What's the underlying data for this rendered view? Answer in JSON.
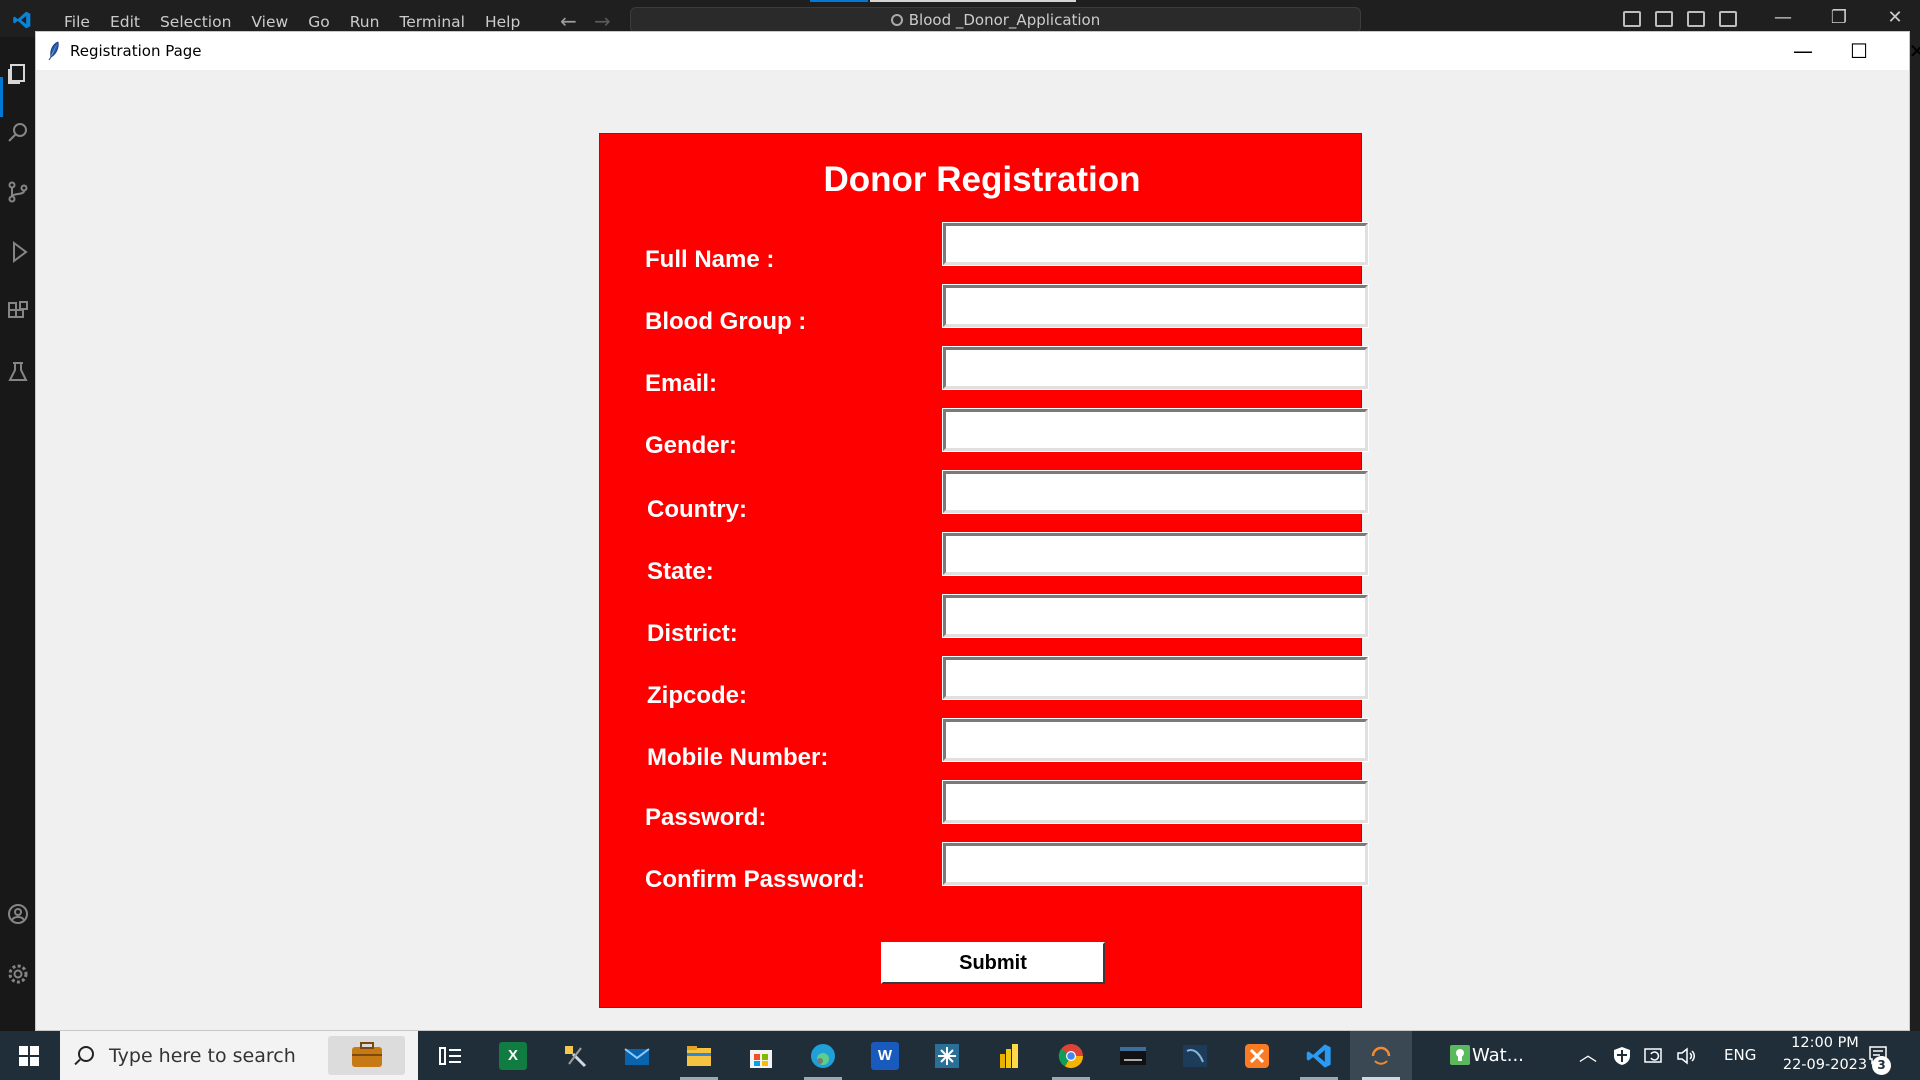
{
  "vscode": {
    "menu": [
      "File",
      "Edit",
      "Selection",
      "View",
      "Go",
      "Run",
      "Terminal",
      "Help"
    ],
    "search_label": "Blood _Donor_Application"
  },
  "window": {
    "title": "Registration Page",
    "minimize": "—",
    "maximize": "☐",
    "close": "✕"
  },
  "form": {
    "title": "Donor Registration",
    "fields": [
      {
        "label": "Full Name :",
        "value": ""
      },
      {
        "label": "Blood Group :",
        "value": ""
      },
      {
        "label": "Email:",
        "value": ""
      },
      {
        "label": "Gender:",
        "value": ""
      },
      {
        "label": "Country:",
        "value": ""
      },
      {
        "label": "State:",
        "value": ""
      },
      {
        "label": "District:",
        "value": ""
      },
      {
        "label": "Zipcode:",
        "value": ""
      },
      {
        "label": "Mobile Number:",
        "value": ""
      },
      {
        "label": "Password:",
        "value": ""
      },
      {
        "label": "Confirm Password:",
        "value": ""
      }
    ],
    "submit_label": "Submit"
  },
  "taskbar": {
    "search_placeholder": "Type here to search",
    "pinned_apps": [
      {
        "name": "task-view-icon"
      },
      {
        "name": "excel-icon",
        "color": "#107c41"
      },
      {
        "name": "tools-icon"
      },
      {
        "name": "mail-icon",
        "color": "#0a64ad"
      },
      {
        "name": "file-explorer-icon",
        "color": "#f5c242"
      },
      {
        "name": "microsoft-store-icon"
      },
      {
        "name": "edge-icon",
        "color": "#1fa0d8"
      },
      {
        "name": "word-icon",
        "color": "#185abd"
      },
      {
        "name": "snowflake-app-icon"
      },
      {
        "name": "power-bi-icon",
        "color": "#f2c811"
      },
      {
        "name": "chrome-icon"
      },
      {
        "name": "mysql-icon"
      },
      {
        "name": "mysql-workbench-icon"
      },
      {
        "name": "xampp-icon",
        "color": "#fb7a24"
      },
      {
        "name": "vscode-icon",
        "color": "#0078d4"
      },
      {
        "name": "python-tk-icon"
      }
    ],
    "watch_label": "Wat...",
    "language": "ENG",
    "time": "12:00 PM",
    "date": "22-09-2023",
    "notification_count": "3"
  },
  "colors": {
    "form_background": "#ff0000",
    "window_background": "#f0f0f0",
    "taskbar": "#202e3a",
    "vscode_accent": "#0078d4"
  }
}
